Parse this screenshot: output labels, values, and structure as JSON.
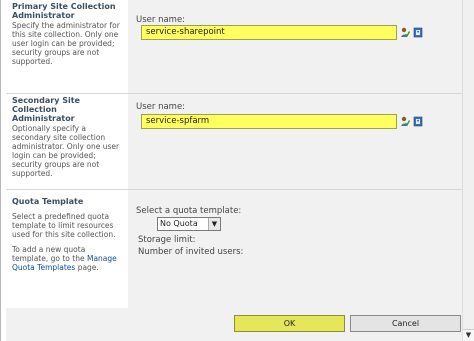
{
  "primary": {
    "title": "Primary Site Collection Administrator",
    "description": "Specify the administrator for this site collection. Only one user login can be provided; security groups are not supported.",
    "user_label": "User name:",
    "user_value": "service-sharepoint",
    "check_icon": "check-names-icon",
    "browse_icon": "address-book-icon"
  },
  "secondary": {
    "title": "Secondary Site Collection Administrator",
    "description": "Optionally specify a secondary site collection administrator. Only one user login can be provided; security groups are not supported.",
    "user_label": "User name:",
    "user_value": "service-spfarm",
    "check_icon": "check-names-icon",
    "browse_icon": "address-book-icon"
  },
  "quota": {
    "title": "Quota Template",
    "description": "Select a predefined quota template to limit resources used for this site collection.",
    "add_text_before": "To add a new quota template, go to the",
    "add_link": "Manage Quota Templates",
    "add_text_after": "page.",
    "select_label": "Select a quota template:",
    "selected": "No Quota",
    "storage_limit": "Storage limit:",
    "invited_users": "Number of invited users:"
  },
  "buttons": {
    "ok": "OK",
    "cancel": "Cancel"
  },
  "colors": {
    "field_highlight": "#ffff60",
    "panel_bg": "#f1f1f1",
    "title_text": "#3b4f65"
  }
}
